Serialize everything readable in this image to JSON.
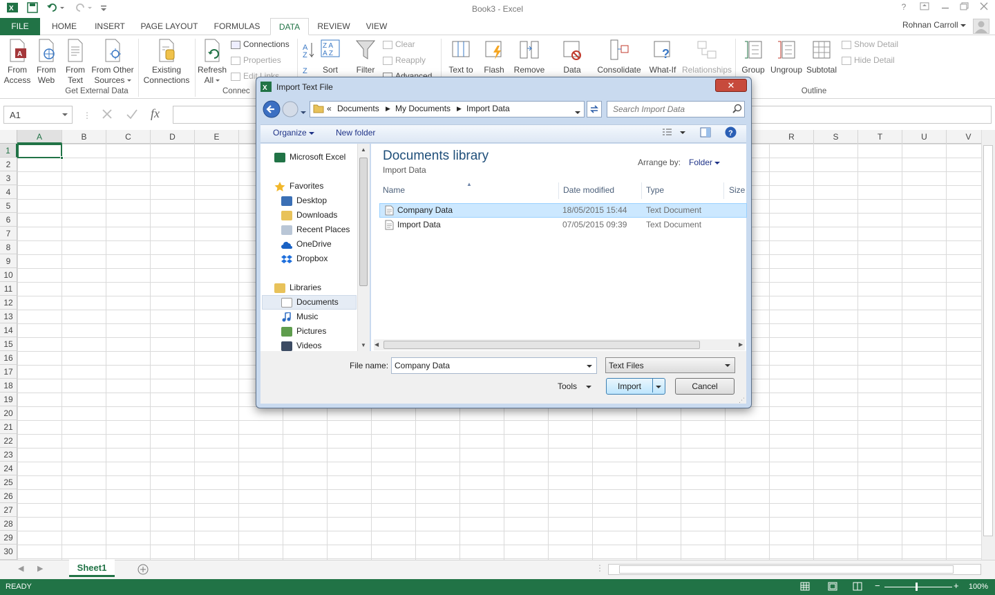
{
  "window": {
    "title": "Book3 - Excel"
  },
  "colors": {
    "accent": "#217346"
  },
  "ribbon_tabs": [
    "FILE",
    "HOME",
    "INSERT",
    "PAGE LAYOUT",
    "FORMULAS",
    "DATA",
    "REVIEW",
    "VIEW"
  ],
  "active_tab": "DATA",
  "user": {
    "name": "Rohnan Carroll"
  },
  "ribbon": {
    "get_external": {
      "from_access": [
        "From",
        "Access"
      ],
      "from_web": [
        "From",
        "Web"
      ],
      "from_text": [
        "From",
        "Text"
      ],
      "from_other": [
        "From Other",
        "Sources"
      ],
      "existing": [
        "Existing",
        "Connections"
      ],
      "group_label": "Get External Data"
    },
    "connections": {
      "refresh": [
        "Refresh",
        "All"
      ],
      "connections": "Connections",
      "properties": "Properties",
      "edit_links": "Edit Links",
      "group_label": "Connec"
    },
    "sort_filter": {
      "sort": "Sort",
      "filter": "Filter",
      "clear": "Clear",
      "reapply": "Reapply",
      "advanced": "Advanced"
    },
    "data_tools": {
      "text_to_columns": "Text to",
      "flash_fill": "Flash",
      "remove": "Remove",
      "validation": "Data",
      "consolidate": "Consolidate",
      "whatif": "What-If",
      "relationships": "Relationships"
    },
    "outline": {
      "group": "Group",
      "ungroup": "Ungroup",
      "subtotal": "Subtotal",
      "show_detail": "Show Detail",
      "hide_detail": "Hide Detail",
      "group_label": "Outline"
    }
  },
  "formula_bar": {
    "name_box": "A1",
    "fx": "fx"
  },
  "columns": [
    "A",
    "B",
    "C",
    "D",
    "E",
    "R",
    "S",
    "T",
    "U",
    "V"
  ],
  "rows": [
    "1",
    "2",
    "3",
    "4",
    "5",
    "6",
    "7",
    "8",
    "9",
    "10",
    "11",
    "12",
    "13",
    "14",
    "15",
    "16",
    "17",
    "18",
    "19",
    "20",
    "21",
    "22",
    "23",
    "24",
    "25",
    "26",
    "27",
    "28",
    "29",
    "30"
  ],
  "sheet_tab": "Sheet1",
  "status": {
    "ready": "READY",
    "zoom": "100%"
  },
  "dialog": {
    "title": "Import Text File",
    "breadcrumb": [
      "«",
      "Documents",
      "My Documents",
      "Import Data"
    ],
    "search_placeholder": "Search Import Data",
    "organize": "Organize",
    "new_folder": "New folder",
    "nav": {
      "microsoft_excel": "Microsoft Excel",
      "favorites": "Favorites",
      "desktop": "Desktop",
      "downloads": "Downloads",
      "recent_places": "Recent Places",
      "onedrive": "OneDrive",
      "dropbox": "Dropbox",
      "libraries": "Libraries",
      "documents": "Documents",
      "music": "Music",
      "pictures": "Pictures",
      "videos": "Videos"
    },
    "library_title": "Documents library",
    "library_sub": "Import Data",
    "arrange_by_label": "Arrange by:",
    "arrange_by_value": "Folder",
    "columns": {
      "name": "Name",
      "date": "Date modified",
      "type": "Type",
      "size": "Size"
    },
    "files": [
      {
        "name": "Company Data",
        "date": "18/05/2015 15:44",
        "type": "Text Document"
      },
      {
        "name": "Import Data",
        "date": "07/05/2015 09:39",
        "type": "Text Document"
      }
    ],
    "file_name_label": "File name:",
    "file_name_value": "Company Data",
    "file_type": "Text Files",
    "tools": "Tools",
    "import": "Import",
    "cancel": "Cancel"
  }
}
